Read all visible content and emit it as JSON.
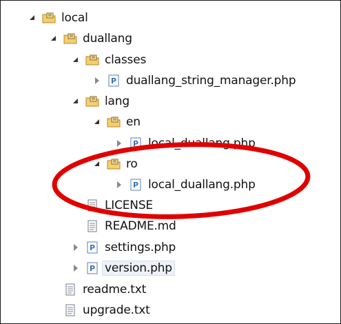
{
  "tree": {
    "items": [
      {
        "label": "local",
        "icon": "package-folder-icon",
        "expanded": true
      },
      {
        "label": "duallang",
        "icon": "package-folder-icon",
        "expanded": true
      },
      {
        "label": "classes",
        "icon": "package-folder-icon",
        "expanded": true
      },
      {
        "label": "duallang_string_manager.php",
        "icon": "php-file-icon",
        "expanded": false
      },
      {
        "label": "lang",
        "icon": "package-folder-icon",
        "expanded": true
      },
      {
        "label": "en",
        "icon": "package-folder-icon",
        "expanded": true
      },
      {
        "label": "local_duallang.php",
        "icon": "php-file-icon",
        "expanded": false
      },
      {
        "label": "ro",
        "icon": "package-folder-icon",
        "expanded": true
      },
      {
        "label": "local_duallang.php",
        "icon": "php-file-icon",
        "expanded": false
      },
      {
        "label": "LICENSE",
        "icon": "text-file-icon"
      },
      {
        "label": "README.md",
        "icon": "text-file-icon"
      },
      {
        "label": "settings.php",
        "icon": "php-file-icon",
        "expanded": false
      },
      {
        "label": "version.php",
        "icon": "php-file-icon",
        "expanded": false,
        "selected": true
      },
      {
        "label": "readme.txt",
        "icon": "text-file-icon"
      },
      {
        "label": "upgrade.txt",
        "icon": "text-file-icon"
      }
    ]
  },
  "colors": {
    "highlight_oval": "#e00000",
    "folder_yellow": "#e8b94a",
    "php_blue": "#3b6fb6"
  }
}
